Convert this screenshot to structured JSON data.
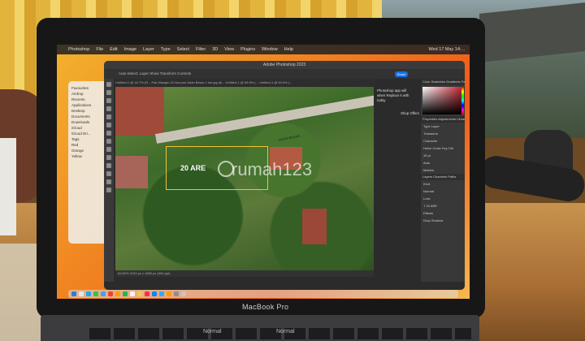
{
  "menubar": {
    "app": "Photoshop",
    "items": [
      "File",
      "Edit",
      "Image",
      "Layer",
      "Type",
      "Select",
      "Filter",
      "3D",
      "View",
      "Plugins",
      "Window",
      "Help"
    ],
    "clock": "Wed 17 May 14:..."
  },
  "finder": {
    "items": [
      "Favourites",
      "Airdrop",
      "Recents",
      "Applications",
      "Desktop",
      "Documents",
      "Downloads",
      "iCloud",
      "iCloud Dri...",
      "Tags",
      "Red",
      "Orange",
      "Yellow"
    ]
  },
  "photoshop": {
    "title": "Adobe Photoshop 2023",
    "options": "Auto-Select:  Layer      Show Transform Controls",
    "share_label": "Share",
    "tabs": "Untitled-1 @ 16.7% (R...   Pak Mangku 20 Are.psd   Jalan Besar 1 are.jpg @...   Untitled-1 @ 83.8% (...   Untitled-1 @ 62.6% (...",
    "plot_label": "20 ARE",
    "road_label": "JALAN BESAR...",
    "status": "83.82%     3103 px x 1800 px (300 ppi)",
    "notification": [
      "Photoshop app will",
      "when Replace it with",
      "today"
    ],
    "notification_link": "Shop Offers",
    "panels": {
      "tabs": "Color  Swatches  Gradients  Patterns",
      "properties_tabs": "Properties  Adjustments  Libraries",
      "rows": [
        "Type Layer",
        "Transform",
        "Character",
        "Helve Cndw Hvy Obl",
        "",
        "39 pt",
        "Auto",
        "Metrics",
        "",
        "Layers  Channels  Paths",
        "Kind",
        "Normal",
        "Lock",
        "T  20 ARE",
        "Effects",
        "Drop Shadow"
      ]
    }
  },
  "laptop": {
    "brand": "MacBook Pro",
    "key_hints": [
      "Normal",
      "Normal"
    ]
  },
  "watermark": "rumah123"
}
